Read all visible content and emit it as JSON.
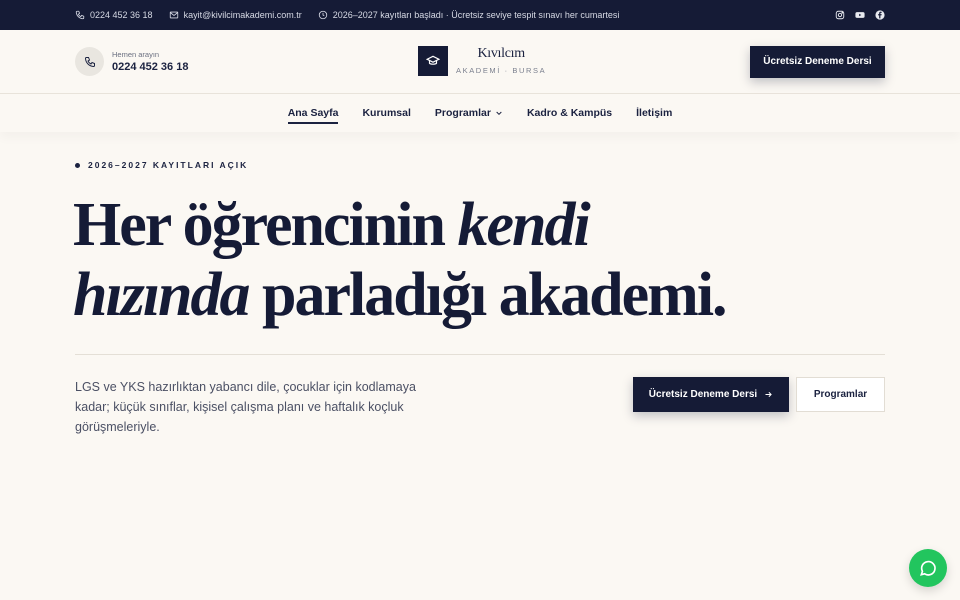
{
  "topbar": {
    "phone": "0224 452 36 18",
    "email": "kayit@kivilcimakademi.com.tr",
    "notice": "2026–2027 kayıtları başladı · Ücretsiz seviye tespit sınavı her cumartesi",
    "icons": [
      "phone-icon",
      "mail-icon",
      "clock-icon",
      "instagram-icon",
      "youtube-icon",
      "facebook-icon"
    ]
  },
  "header": {
    "call_label": "Hemen arayın",
    "call_number": "0224 452 36 18",
    "logo_name": "Kıvılcım",
    "logo_sub": "AKADEMİ · BURSA",
    "cta": "Ücretsiz Deneme Dersi"
  },
  "nav": {
    "items": [
      {
        "label": "Ana Sayfa"
      },
      {
        "label": "Kurumsal"
      },
      {
        "label": "Programlar"
      },
      {
        "label": "Kadro & Kampüs"
      },
      {
        "label": "İletişim"
      }
    ],
    "active": "Ana Sayfa"
  },
  "hero": {
    "eyebrow": "2026–2027 KAYITLARI AÇIK",
    "headline_part1": "Her öğrencinin ",
    "headline_em1": "kendi",
    "headline_em2": "hızında",
    "headline_part2": " parladığı akademi.",
    "description": "LGS ve YKS hazırlıktan yabancı dile, çocuklar için kodlamaya kadar; küçük sınıflar, kişisel çalışma planı ve haftalık koçluk görüşmeleriyle.",
    "primary_button": "Ücretsiz Deneme Dersi",
    "secondary_button": "Programlar"
  },
  "colors": {
    "navy": "#151b36",
    "background": "#fbf8f3",
    "whatsapp": "#22c55e"
  }
}
